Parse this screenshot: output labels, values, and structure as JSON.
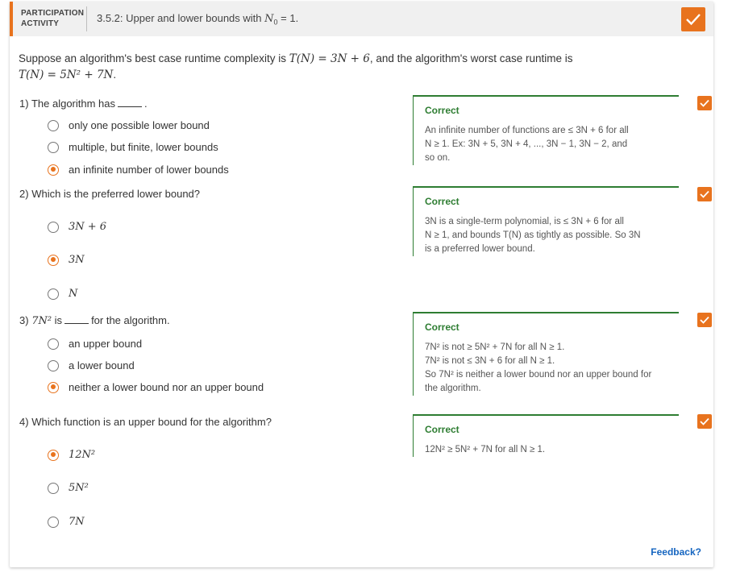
{
  "header": {
    "participation_line1": "PARTICIPATION",
    "participation_line2": "ACTIVITY",
    "title_prefix": "3.5.2: Upper and lower bounds with ",
    "title_math": "N",
    "title_sub": "0",
    "title_suffix": " = 1."
  },
  "intro": {
    "text1": "Suppose an algorithm's best case runtime complexity is ",
    "best_case": "T(N) = 3N + 6",
    "text2": ", and the algorithm's worst case runtime is ",
    "worst_case": "T(N) = 5N² + 7N",
    "text3": "."
  },
  "questions": [
    {
      "number": "1)",
      "prompt_before": "The algorithm has",
      "prompt_after": ".",
      "options": [
        "only one possible lower bound",
        "multiple, but finite, lower bounds",
        "an infinite number of lower bounds"
      ],
      "selected": 2,
      "feedback_title": "Correct",
      "feedback_lines": [
        "An infinite number of functions are ≤ 3N + 6 for all",
        "N ≥ 1. Ex: 3N + 5, 3N + 4, ..., 3N − 1, 3N − 2, and",
        "so on."
      ]
    },
    {
      "number": "2)",
      "prompt": "Which is the preferred lower bound?",
      "options": [
        "3N + 6",
        "3N",
        "N"
      ],
      "selected": 1,
      "feedback_title": "Correct",
      "feedback_lines": [
        "3N is a single-term polynomial, is ≤ 3N + 6 for all",
        "N ≥ 1, and bounds T(N) as tightly as possible. So 3N",
        "is a preferred lower bound."
      ]
    },
    {
      "number": "3)",
      "prompt_math": "7N²",
      "prompt_mid": "is",
      "prompt_after": "for the algorithm.",
      "options": [
        "an upper bound",
        "a lower bound",
        "neither a lower bound nor an upper bound"
      ],
      "selected": 2,
      "feedback_title": "Correct",
      "feedback_lines": [
        "7N² is not ≥ 5N² + 7N for all N ≥ 1.",
        "7N² is not ≤ 3N + 6 for all N ≥ 1.",
        "So 7N² is neither a lower bound nor an upper bound for",
        "the algorithm."
      ]
    },
    {
      "number": "4)",
      "prompt": "Which function is an upper bound for the algorithm?",
      "options": [
        "12N²",
        "5N²",
        "7N"
      ],
      "selected": 0,
      "feedback_title": "Correct",
      "feedback_lines": [
        "12N² ≥ 5N² + 7N for all N ≥ 1."
      ]
    }
  ],
  "footer": {
    "feedback_link": "Feedback?"
  },
  "colors": {
    "accent": "#e8731e",
    "correct": "#2e7d32",
    "link": "#1565c0"
  },
  "icons": {
    "check": "check-icon"
  }
}
